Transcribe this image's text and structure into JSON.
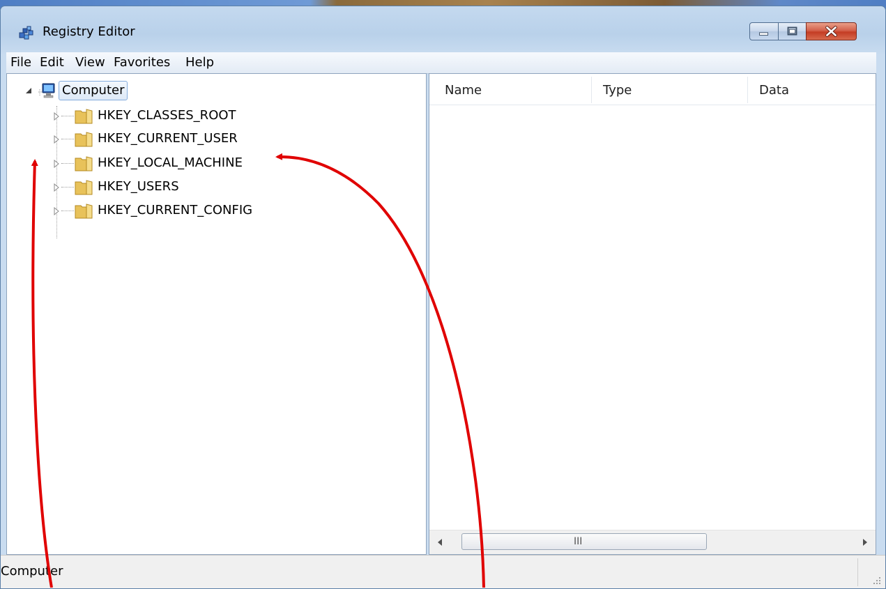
{
  "window": {
    "title": "Registry Editor",
    "app_icon": "registry-editor-icon"
  },
  "menu": {
    "items": [
      "File",
      "Edit",
      "View",
      "Favorites",
      "Help"
    ]
  },
  "tree": {
    "root_label": "Computer",
    "root_icon": "computer-icon",
    "hives": [
      "HKEY_CLASSES_ROOT",
      "HKEY_CURRENT_USER",
      "HKEY_LOCAL_MACHINE",
      "HKEY_USERS",
      "HKEY_CURRENT_CONFIG"
    ]
  },
  "list": {
    "columns": [
      "Name",
      "Type",
      "Data"
    ],
    "scroll_grip": "III"
  },
  "status_bar": {
    "path": "Computer"
  },
  "colors": {
    "annotation_arrow": "#e00000",
    "title_bar": "#b9d1ea",
    "close_button": "#c43c24"
  }
}
